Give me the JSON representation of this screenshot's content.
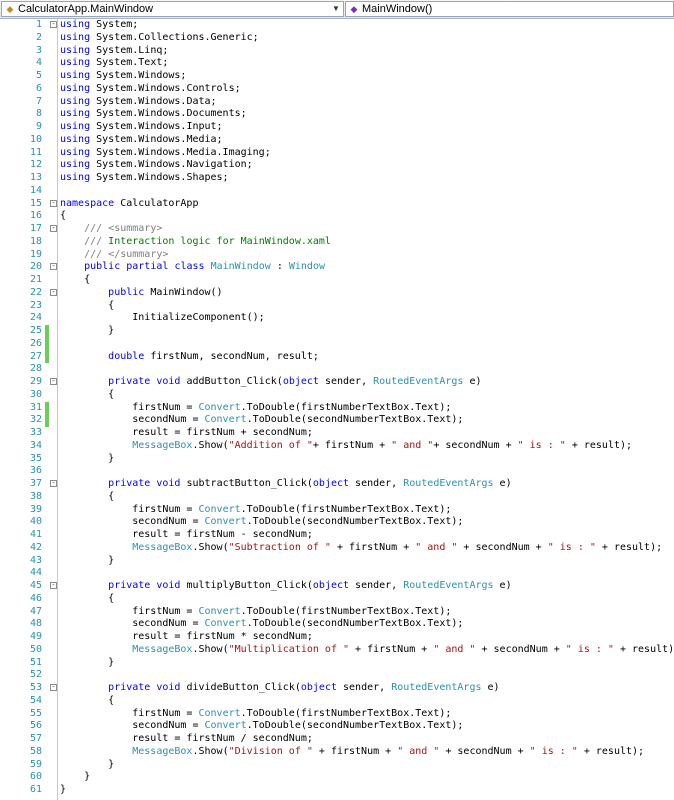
{
  "nav": {
    "class_combo": "CalculatorApp.MainWindow",
    "member_combo": "MainWindow()"
  },
  "colors": {
    "keyword": "#0000ff",
    "type": "#2b91af",
    "string": "#a31515",
    "comment": "#008000",
    "xmldoc": "#808080",
    "line_number": "#2b91af",
    "change_marker": "#6ccd59"
  },
  "icons": {
    "class": "class-icon",
    "method": "method-icon",
    "dropdown": "chevron-down-icon",
    "fold": "fold-toggle-icon"
  },
  "lines": [
    {
      "n": "1",
      "fold": "-",
      "tokens": [
        [
          "kw",
          "using"
        ],
        [
          "t",
          " System;"
        ]
      ]
    },
    {
      "n": "2",
      "tokens": [
        [
          "kw",
          "using"
        ],
        [
          "t",
          " System.Collections.Generic;"
        ]
      ]
    },
    {
      "n": "3",
      "tokens": [
        [
          "kw",
          "using"
        ],
        [
          "t",
          " System.Linq;"
        ]
      ]
    },
    {
      "n": "4",
      "tokens": [
        [
          "kw",
          "using"
        ],
        [
          "t",
          " System.Text;"
        ]
      ]
    },
    {
      "n": "5",
      "tokens": [
        [
          "kw",
          "using"
        ],
        [
          "t",
          " System.Windows;"
        ]
      ]
    },
    {
      "n": "6",
      "tokens": [
        [
          "kw",
          "using"
        ],
        [
          "t",
          " System.Windows.Controls;"
        ]
      ]
    },
    {
      "n": "7",
      "tokens": [
        [
          "kw",
          "using"
        ],
        [
          "t",
          " System.Windows.Data;"
        ]
      ]
    },
    {
      "n": "8",
      "tokens": [
        [
          "kw",
          "using"
        ],
        [
          "t",
          " System.Windows.Documents;"
        ]
      ]
    },
    {
      "n": "9",
      "tokens": [
        [
          "kw",
          "using"
        ],
        [
          "t",
          " System.Windows.Input;"
        ]
      ]
    },
    {
      "n": "10",
      "tokens": [
        [
          "kw",
          "using"
        ],
        [
          "t",
          " System.Windows.Media;"
        ]
      ]
    },
    {
      "n": "11",
      "tokens": [
        [
          "kw",
          "using"
        ],
        [
          "t",
          " System.Windows.Media.Imaging;"
        ]
      ]
    },
    {
      "n": "12",
      "tokens": [
        [
          "kw",
          "using"
        ],
        [
          "t",
          " System.Windows.Navigation;"
        ]
      ]
    },
    {
      "n": "13",
      "tokens": [
        [
          "kw",
          "using"
        ],
        [
          "t",
          " System.Windows.Shapes;"
        ]
      ]
    },
    {
      "n": "14",
      "tokens": []
    },
    {
      "n": "15",
      "fold": "-",
      "tokens": [
        [
          "kw",
          "namespace"
        ],
        [
          "t",
          " CalculatorApp"
        ]
      ]
    },
    {
      "n": "16",
      "tokens": [
        [
          "t",
          "{"
        ]
      ]
    },
    {
      "n": "17",
      "fold": "-",
      "tokens": [
        [
          "t",
          "    "
        ],
        [
          "xd",
          "///"
        ],
        [
          "cm",
          " "
        ],
        [
          "xd",
          "<summary>"
        ]
      ]
    },
    {
      "n": "18",
      "tokens": [
        [
          "t",
          "    "
        ],
        [
          "xd",
          "///"
        ],
        [
          "cm",
          " Interaction logic for MainWindow.xaml"
        ]
      ]
    },
    {
      "n": "19",
      "tokens": [
        [
          "t",
          "    "
        ],
        [
          "xd",
          "///"
        ],
        [
          "cm",
          " "
        ],
        [
          "xd",
          "</summary>"
        ]
      ]
    },
    {
      "n": "20",
      "fold": "-",
      "tokens": [
        [
          "t",
          "    "
        ],
        [
          "kw",
          "public"
        ],
        [
          "t",
          " "
        ],
        [
          "kw",
          "partial"
        ],
        [
          "t",
          " "
        ],
        [
          "kw",
          "class"
        ],
        [
          "t",
          " "
        ],
        [
          "ty",
          "MainWindow"
        ],
        [
          "t",
          " : "
        ],
        [
          "ty",
          "Window"
        ]
      ]
    },
    {
      "n": "21",
      "tokens": [
        [
          "t",
          "    {"
        ]
      ]
    },
    {
      "n": "22",
      "fold": "-",
      "tokens": [
        [
          "t",
          "        "
        ],
        [
          "kw",
          "public"
        ],
        [
          "t",
          " MainWindow()"
        ]
      ]
    },
    {
      "n": "23",
      "tokens": [
        [
          "t",
          "        {"
        ]
      ]
    },
    {
      "n": "24",
      "tokens": [
        [
          "t",
          "            InitializeComponent();"
        ]
      ]
    },
    {
      "n": "25",
      "changed": true,
      "tokens": [
        [
          "t",
          "        }"
        ]
      ]
    },
    {
      "n": "26",
      "changed": true,
      "tokens": []
    },
    {
      "n": "27",
      "changed": true,
      "tokens": [
        [
          "t",
          "        "
        ],
        [
          "kw",
          "double"
        ],
        [
          "t",
          " firstNum, secondNum, result;"
        ]
      ]
    },
    {
      "n": "28",
      "tokens": []
    },
    {
      "n": "29",
      "fold": "-",
      "tokens": [
        [
          "t",
          "        "
        ],
        [
          "kw",
          "private"
        ],
        [
          "t",
          " "
        ],
        [
          "kw",
          "void"
        ],
        [
          "t",
          " addButton_Click("
        ],
        [
          "kw",
          "object"
        ],
        [
          "t",
          " sender, "
        ],
        [
          "ty",
          "RoutedEventArgs"
        ],
        [
          "t",
          " e)"
        ]
      ]
    },
    {
      "n": "30",
      "tokens": [
        [
          "t",
          "        {"
        ]
      ]
    },
    {
      "n": "31",
      "changed": true,
      "tokens": [
        [
          "t",
          "            firstNum = "
        ],
        [
          "ty",
          "Convert"
        ],
        [
          "t",
          ".ToDouble(firstNumberTextBox.Text);"
        ]
      ]
    },
    {
      "n": "32",
      "changed": true,
      "tokens": [
        [
          "t",
          "            secondNum = "
        ],
        [
          "ty",
          "Convert"
        ],
        [
          "t",
          ".ToDouble(secondNumberTextBox.Text);"
        ]
      ]
    },
    {
      "n": "33",
      "tokens": [
        [
          "t",
          "            result = firstNum + secondNum;"
        ]
      ]
    },
    {
      "n": "34",
      "tokens": [
        [
          "t",
          "            "
        ],
        [
          "ty",
          "MessageBox"
        ],
        [
          "t",
          ".Show("
        ],
        [
          "str",
          "\"Addition of \""
        ],
        [
          "t",
          "+ firstNum + "
        ],
        [
          "str",
          "\" and \""
        ],
        [
          "t",
          "+ secondNum + "
        ],
        [
          "str",
          "\" is : \""
        ],
        [
          "t",
          " + result);"
        ]
      ]
    },
    {
      "n": "35",
      "tokens": [
        [
          "t",
          "        }"
        ]
      ]
    },
    {
      "n": "36",
      "tokens": []
    },
    {
      "n": "37",
      "fold": "-",
      "tokens": [
        [
          "t",
          "        "
        ],
        [
          "kw",
          "private"
        ],
        [
          "t",
          " "
        ],
        [
          "kw",
          "void"
        ],
        [
          "t",
          " subtractButton_Click("
        ],
        [
          "kw",
          "object"
        ],
        [
          "t",
          " sender, "
        ],
        [
          "ty",
          "RoutedEventArgs"
        ],
        [
          "t",
          " e)"
        ]
      ]
    },
    {
      "n": "38",
      "tokens": [
        [
          "t",
          "        {"
        ]
      ]
    },
    {
      "n": "39",
      "tokens": [
        [
          "t",
          "            firstNum = "
        ],
        [
          "ty",
          "Convert"
        ],
        [
          "t",
          ".ToDouble(firstNumberTextBox.Text);"
        ]
      ]
    },
    {
      "n": "40",
      "tokens": [
        [
          "t",
          "            secondNum = "
        ],
        [
          "ty",
          "Convert"
        ],
        [
          "t",
          ".ToDouble(secondNumberTextBox.Text);"
        ]
      ]
    },
    {
      "n": "41",
      "tokens": [
        [
          "t",
          "            result = firstNum - secondNum;"
        ]
      ]
    },
    {
      "n": "42",
      "tokens": [
        [
          "t",
          "            "
        ],
        [
          "ty",
          "MessageBox"
        ],
        [
          "t",
          ".Show("
        ],
        [
          "str",
          "\"Subtraction of \""
        ],
        [
          "t",
          " + firstNum + "
        ],
        [
          "str",
          "\" and \""
        ],
        [
          "t",
          " + secondNum + "
        ],
        [
          "str",
          "\" is : \""
        ],
        [
          "t",
          " + result);"
        ]
      ]
    },
    {
      "n": "43",
      "tokens": [
        [
          "t",
          "        }"
        ]
      ]
    },
    {
      "n": "44",
      "tokens": []
    },
    {
      "n": "45",
      "fold": "-",
      "tokens": [
        [
          "t",
          "        "
        ],
        [
          "kw",
          "private"
        ],
        [
          "t",
          " "
        ],
        [
          "kw",
          "void"
        ],
        [
          "t",
          " multiplyButton_Click("
        ],
        [
          "kw",
          "object"
        ],
        [
          "t",
          " sender, "
        ],
        [
          "ty",
          "RoutedEventArgs"
        ],
        [
          "t",
          " e)"
        ]
      ]
    },
    {
      "n": "46",
      "tokens": [
        [
          "t",
          "        {"
        ]
      ]
    },
    {
      "n": "47",
      "tokens": [
        [
          "t",
          "            firstNum = "
        ],
        [
          "ty",
          "Convert"
        ],
        [
          "t",
          ".ToDouble(firstNumberTextBox.Text);"
        ]
      ]
    },
    {
      "n": "48",
      "tokens": [
        [
          "t",
          "            secondNum = "
        ],
        [
          "ty",
          "Convert"
        ],
        [
          "t",
          ".ToDouble(secondNumberTextBox.Text);"
        ]
      ]
    },
    {
      "n": "49",
      "tokens": [
        [
          "t",
          "            result = firstNum * secondNum;"
        ]
      ]
    },
    {
      "n": "50",
      "tokens": [
        [
          "t",
          "            "
        ],
        [
          "ty",
          "MessageBox"
        ],
        [
          "t",
          ".Show("
        ],
        [
          "str",
          "\"Multiplication of \""
        ],
        [
          "t",
          " + firstNum + "
        ],
        [
          "str",
          "\" and \""
        ],
        [
          "t",
          " + secondNum + "
        ],
        [
          "str",
          "\" is : \""
        ],
        [
          "t",
          " + result);"
        ]
      ]
    },
    {
      "n": "51",
      "tokens": [
        [
          "t",
          "        }"
        ]
      ]
    },
    {
      "n": "52",
      "tokens": []
    },
    {
      "n": "53",
      "fold": "-",
      "tokens": [
        [
          "t",
          "        "
        ],
        [
          "kw",
          "private"
        ],
        [
          "t",
          " "
        ],
        [
          "kw",
          "void"
        ],
        [
          "t",
          " divideButton_Click("
        ],
        [
          "kw",
          "object"
        ],
        [
          "t",
          " sender, "
        ],
        [
          "ty",
          "RoutedEventArgs"
        ],
        [
          "t",
          " e)"
        ]
      ]
    },
    {
      "n": "54",
      "tokens": [
        [
          "t",
          "        {"
        ]
      ]
    },
    {
      "n": "55",
      "tokens": [
        [
          "t",
          "            firstNum = "
        ],
        [
          "ty",
          "Convert"
        ],
        [
          "t",
          ".ToDouble(firstNumberTextBox.Text);"
        ]
      ]
    },
    {
      "n": "56",
      "tokens": [
        [
          "t",
          "            secondNum = "
        ],
        [
          "ty",
          "Convert"
        ],
        [
          "t",
          ".ToDouble(secondNumberTextBox.Text);"
        ]
      ]
    },
    {
      "n": "57",
      "tokens": [
        [
          "t",
          "            result = firstNum / secondNum;"
        ]
      ]
    },
    {
      "n": "58",
      "tokens": [
        [
          "t",
          "            "
        ],
        [
          "ty",
          "MessageBox"
        ],
        [
          "t",
          ".Show("
        ],
        [
          "str",
          "\"Division of \""
        ],
        [
          "t",
          " + firstNum + "
        ],
        [
          "str",
          "\" and \""
        ],
        [
          "t",
          " + secondNum + "
        ],
        [
          "str",
          "\" is : \""
        ],
        [
          "t",
          " + result);"
        ]
      ]
    },
    {
      "n": "59",
      "tokens": [
        [
          "t",
          "        }"
        ]
      ]
    },
    {
      "n": "60",
      "tokens": [
        [
          "t",
          "    }"
        ]
      ]
    },
    {
      "n": "61",
      "tokens": [
        [
          "t",
          "}"
        ]
      ]
    }
  ]
}
